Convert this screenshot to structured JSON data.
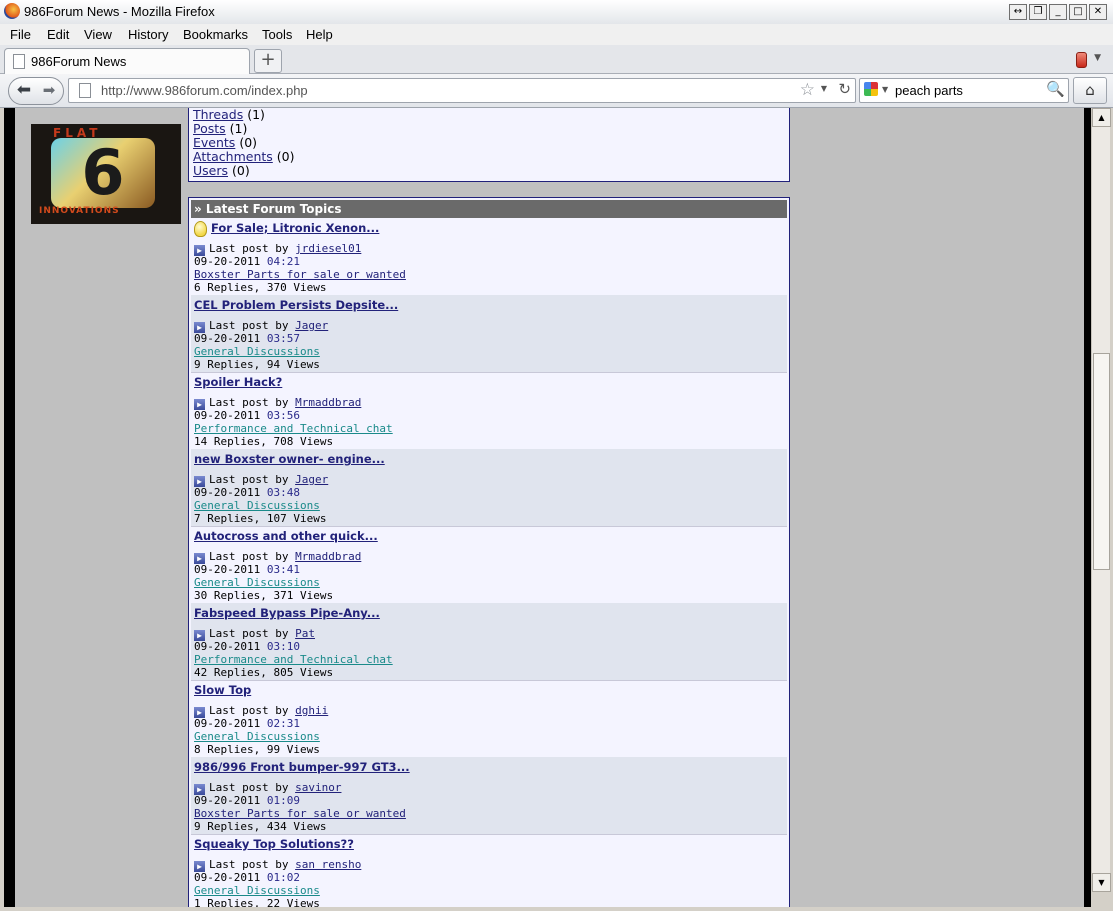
{
  "window": {
    "title": "986Forum News - Mozilla Firefox",
    "buttons": [
      "↔",
      "❒",
      "_",
      "□",
      "✕"
    ]
  },
  "menu": [
    "File",
    "Edit",
    "View",
    "History",
    "Bookmarks",
    "Tools",
    "Help"
  ],
  "tab": {
    "label": "986Forum News",
    "new_tab": "+"
  },
  "nav": {
    "url": "http://www.986forum.com/index.php",
    "search_value": "peach parts"
  },
  "logo": {
    "top_text": "FLAT",
    "big_char": "6",
    "bottom_text": "INNOVATIONS"
  },
  "search_results": [
    {
      "label": "Threads",
      "count": "(1)"
    },
    {
      "label": "Posts",
      "count": "(1)"
    },
    {
      "label": "Events",
      "count": "(0)"
    },
    {
      "label": "Attachments",
      "count": "(0)"
    },
    {
      "label": "Users",
      "count": "(0)"
    }
  ],
  "latest": {
    "header": "» Latest Forum Topics",
    "last_post_prefix": "Last post by",
    "topics": [
      {
        "title": "For Sale; Litronic Xenon...",
        "user": "jrdiesel01",
        "date": "09-20-2011",
        "time": "04:21",
        "forum": "Boxster Parts for sale or wanted",
        "stats": "6 Replies, 370 Views"
      },
      {
        "title": "CEL Problem Persists Depsite...",
        "user": "Jager",
        "date": "09-20-2011",
        "time": "03:57",
        "forum": "General Discussions",
        "stats": "9 Replies, 94 Views"
      },
      {
        "title": "Spoiler Hack?",
        "user": "Mrmaddbrad",
        "date": "09-20-2011",
        "time": "03:56",
        "forum": "Performance and Technical chat",
        "stats": "14 Replies, 708 Views"
      },
      {
        "title": "new Boxster owner- engine...",
        "user": "Jager",
        "date": "09-20-2011",
        "time": "03:48",
        "forum": "General Discussions",
        "stats": "7 Replies, 107 Views"
      },
      {
        "title": "Autocross and other quick...",
        "user": "Mrmaddbrad",
        "date": "09-20-2011",
        "time": "03:41",
        "forum": "General Discussions",
        "stats": "30 Replies, 371 Views"
      },
      {
        "title": "Fabspeed Bypass Pipe-Any...",
        "user": "Pat",
        "date": "09-20-2011",
        "time": "03:10",
        "forum": "Performance and Technical chat",
        "stats": "42 Replies, 805 Views"
      },
      {
        "title": "Slow Top",
        "user": "dghii",
        "date": "09-20-2011",
        "time": "02:31",
        "forum": "General Discussions",
        "stats": "8 Replies, 99 Views"
      },
      {
        "title": "986/996 Front bumper-997 GT3...",
        "user": "savinor",
        "date": "09-20-2011",
        "time": "01:09",
        "forum": "Boxster Parts for sale or wanted",
        "stats": "9 Replies, 434 Views"
      },
      {
        "title": "Squeaky Top Solutions??",
        "user": "san rensho",
        "date": "09-20-2011",
        "time": "01:02",
        "forum": "General Discussions",
        "stats": "1 Replies, 22 Views"
      }
    ]
  },
  "colors": {
    "link": "#22227a",
    "forum_link": "#1a8a8a",
    "header_bg": "#6a6a6a",
    "box_bg": "#f4f4ff",
    "alt_row": "#e0e4ee"
  }
}
